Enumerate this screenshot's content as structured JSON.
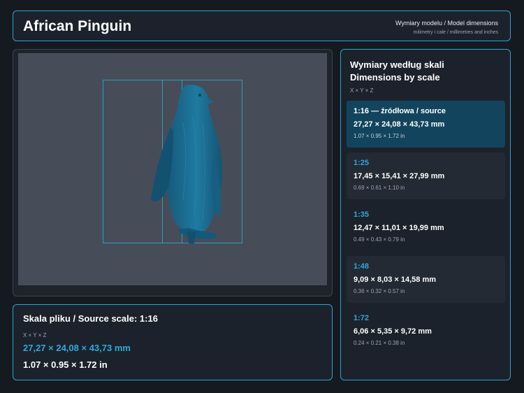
{
  "header": {
    "title": "African Pinguin",
    "subtitle": "Wymiary modelu / Model dimensions",
    "units_note": "milimetry i cale / millimetres and inches"
  },
  "viewer": {
    "model_color": "#1d6e8f",
    "background_color": "#464d58",
    "bbox_color": "#2d9bc1"
  },
  "source_scale": {
    "title": "Skala pliku / Source scale: 1:16",
    "axes": "X × Y × Z",
    "mm": "27,27 × 24,08 × 43,73 mm",
    "inches": "1.07 × 0.95 × 1.72 in"
  },
  "dimensions": {
    "title": "Wymiary według skali Dimensions by scale",
    "axes": "X × Y × Z",
    "scales": [
      {
        "label": "1:16  —  źródłowa / source",
        "mm": "27,27 × 24,08 × 43,73 mm",
        "inches": "1.07 × 0.95 × 1.72 in"
      },
      {
        "label": "1:25",
        "mm": "17,45 × 15,41 × 27,99 mm",
        "inches": "0.69 × 0.61 × 1.10 in"
      },
      {
        "label": "1:35",
        "mm": "12,47 × 11,01 × 19,99 mm",
        "inches": "0.49 × 0.43 × 0.79 in"
      },
      {
        "label": "1:48",
        "mm": "9,09 × 8,03 × 14,58 mm",
        "inches": "0.36 × 0.32 × 0.57 in"
      },
      {
        "label": "1:72",
        "mm": "6,06 × 5,35 × 9,72 mm",
        "inches": "0.24 × 0.21 × 0.38 in"
      }
    ]
  },
  "colors": {
    "accent": "#2fa9dc",
    "active_card": "#13445d",
    "panel_border": "#2fa2cf"
  }
}
